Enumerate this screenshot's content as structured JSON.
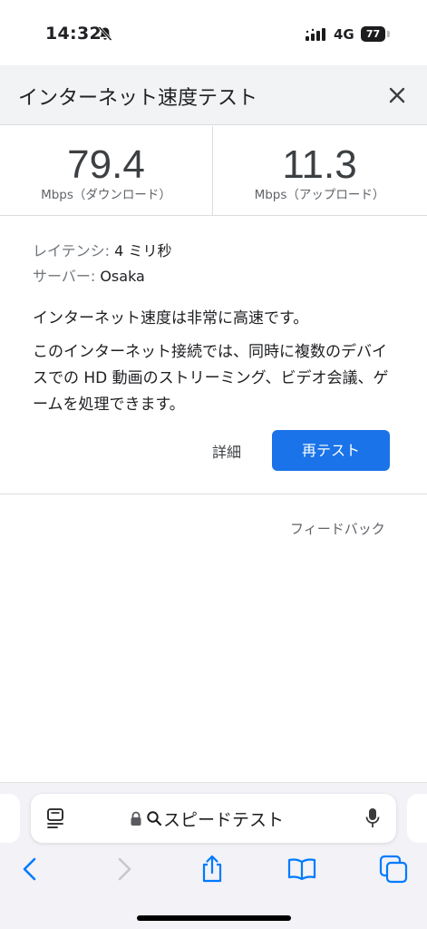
{
  "status_bar": {
    "time": "14:32",
    "network": "4G",
    "battery_percent": "77",
    "battery_level": 0.77,
    "icons": [
      "bell-slash-icon",
      "signal-icon",
      "battery-icon"
    ]
  },
  "header": {
    "title": "インターネット速度テスト",
    "close_icon": "close-icon"
  },
  "results": {
    "download": {
      "value": "79.4",
      "unit": "Mbps（ダウンロード）"
    },
    "upload": {
      "value": "11.3",
      "unit": "Mbps（アップロード）"
    }
  },
  "details": {
    "latency_label": "レイテンシ:",
    "latency_value": "4 ミリ秒",
    "server_label": "サーバー:",
    "server_value": "Osaka",
    "summary": "インターネット速度は非常に高速です。",
    "description": "このインターネット接続では、同時に複数のデバイスでの HD 動画のストリーミング、ビデオ会議、ゲームを処理できます。",
    "details_link": "詳細",
    "retest_button": "再テスト"
  },
  "feedback_link": "フィードバック",
  "browser": {
    "address_text": "スピードテスト",
    "icons": [
      "reader-icon",
      "lock-icon",
      "search-icon",
      "microphone-icon",
      "back-icon",
      "forward-icon",
      "share-icon",
      "bookmarks-icon",
      "tabs-icon"
    ]
  },
  "colors": {
    "accent": "#1a73e8",
    "ios_blue": "#007aff"
  }
}
